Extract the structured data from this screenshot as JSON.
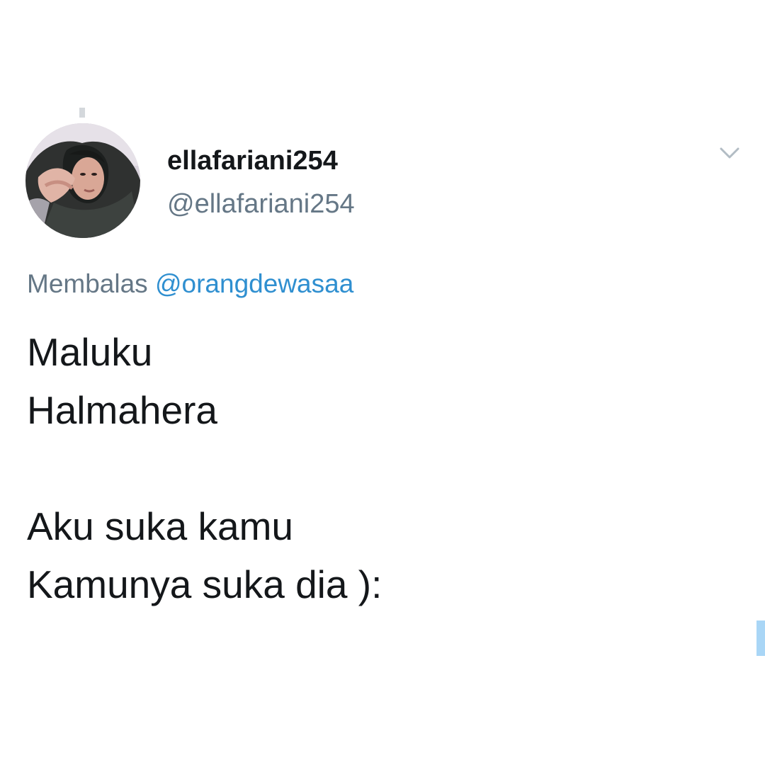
{
  "tweet": {
    "display_name": "ellafariani254",
    "handle": "@ellafariani254",
    "reply_prefix": "Membalas",
    "reply_to": "@orangdewasaa",
    "lines": [
      "Maluku",
      "Halmahera",
      "",
      "Aku suka kamu",
      "Kamunya suka dia ):"
    ]
  },
  "icons": {
    "menu": "chevron-down-icon",
    "avatar": "profile-photo"
  },
  "colors": {
    "background": "#ffffff",
    "text": "#14171a",
    "secondary_text": "#657786",
    "link": "#2f8fd0",
    "accent_marker": "#a9d6f6"
  }
}
